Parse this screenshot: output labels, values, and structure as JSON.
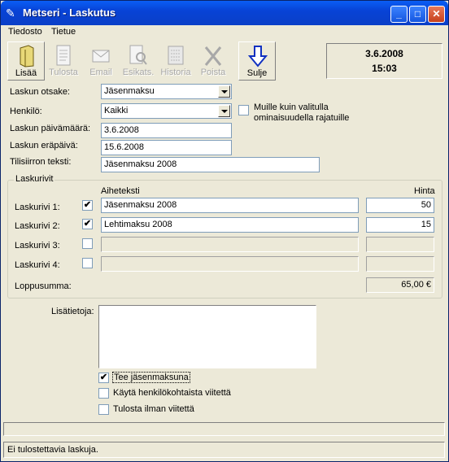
{
  "window": {
    "title": "Metseri - Laskutus"
  },
  "menu": {
    "file": "Tiedosto",
    "data": "Tietue"
  },
  "toolbar": {
    "add": "Lisää",
    "print": "Tulosta",
    "email": "Email",
    "preview": "Esikats.",
    "history": "Historia",
    "delete": "Poista",
    "close": "Sulje"
  },
  "clock": {
    "date": "3.6.2008",
    "time": "15:03"
  },
  "form": {
    "header_label": "Laskun otsake:",
    "header_value": "Jäsenmaksu",
    "person_label": "Henkilö:",
    "person_value": "Kaikki",
    "restrict_label": "Muille kuin valitulla ominaisuudella rajatuille",
    "date_label": "Laskun päivämäärä:",
    "date_value": "3.6.2008",
    "due_label": "Laskun eräpäivä:",
    "due_value": "15.6.2008",
    "transfer_label": "Tilisiirron teksti:",
    "transfer_value": "Jäsenmaksu 2008"
  },
  "rows": {
    "title": "Laskurivit",
    "col_subject": "Aiheteksti",
    "col_price": "Hinta",
    "r1_label": "Laskurivi 1:",
    "r1_subject": "Jäsenmaksu 2008",
    "r1_price": "50",
    "r1_checked": "✔",
    "r2_label": "Laskurivi 2:",
    "r2_subject": "Lehtimaksu 2008",
    "r2_price": "15",
    "r2_checked": "✔",
    "r3_label": "Laskurivi 3:",
    "r4_label": "Laskurivi 4:",
    "total_label": "Loppusumma:",
    "total_value": "65,00 €"
  },
  "extra": {
    "info_label": "Lisätietoja:",
    "opt1": "Tee jäsenmaksuna",
    "opt1_checked": "✔",
    "opt2": "Käytä henkilökohtaista viitettä",
    "opt3": "Tulosta ilman viitettä"
  },
  "status": {
    "text": "Ei tulostettavia laskuja."
  }
}
